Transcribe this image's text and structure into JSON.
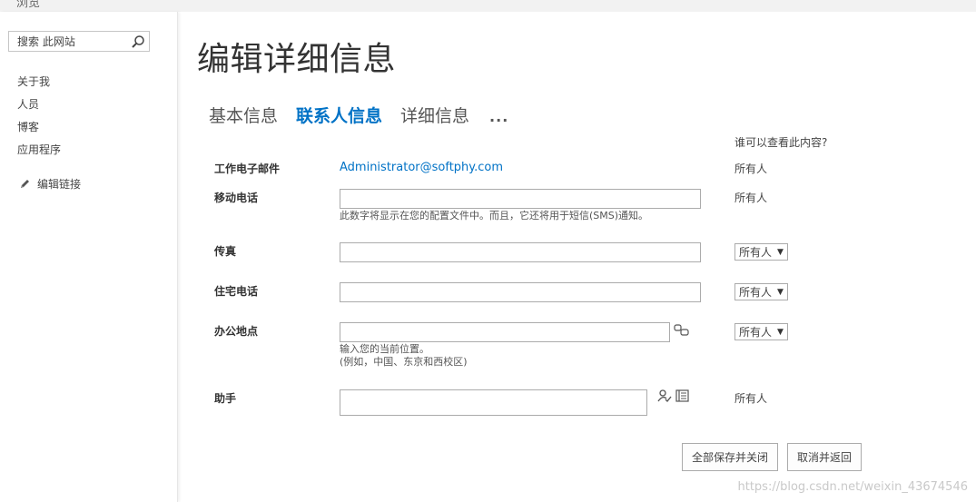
{
  "topbar": {
    "label": "浏览"
  },
  "sidebar": {
    "search_placeholder": "搜索 此网站",
    "items": [
      {
        "label": "关于我"
      },
      {
        "label": "人员"
      },
      {
        "label": "博客"
      },
      {
        "label": "应用程序"
      }
    ],
    "edit_links_label": "编辑链接"
  },
  "page": {
    "title": "编辑详细信息"
  },
  "tabs": [
    {
      "label": "基本信息",
      "active": false
    },
    {
      "label": "联系人信息",
      "active": true
    },
    {
      "label": "详细信息",
      "active": false
    }
  ],
  "tabs_more": "...",
  "privacy_header": "谁可以查看此内容?",
  "fields": {
    "work_email": {
      "label": "工作电子邮件",
      "value": "Administrator@softphy.com",
      "privacy": "所有人"
    },
    "mobile": {
      "label": "移动电话",
      "value": "",
      "hint": "此数字将显示在您的配置文件中。而且，它还将用于短信(SMS)通知。",
      "privacy": "所有人"
    },
    "fax": {
      "label": "传真",
      "value": "",
      "privacy": "所有人"
    },
    "home_phone": {
      "label": "住宅电话",
      "value": "",
      "privacy": "所有人"
    },
    "office": {
      "label": "办公地点",
      "value": "",
      "hint_line1": "输入您的当前位置。",
      "hint_line2": "(例如，中国、东京和西校区)",
      "privacy": "所有人"
    },
    "assistant": {
      "label": "助手",
      "value": "",
      "privacy": "所有人"
    }
  },
  "buttons": {
    "save_all_close": "全部保存并关闭",
    "cancel_back": "取消并返回"
  },
  "watermark": "https://blog.csdn.net/weixin_43674546",
  "colors": {
    "accent": "#0072c6"
  }
}
